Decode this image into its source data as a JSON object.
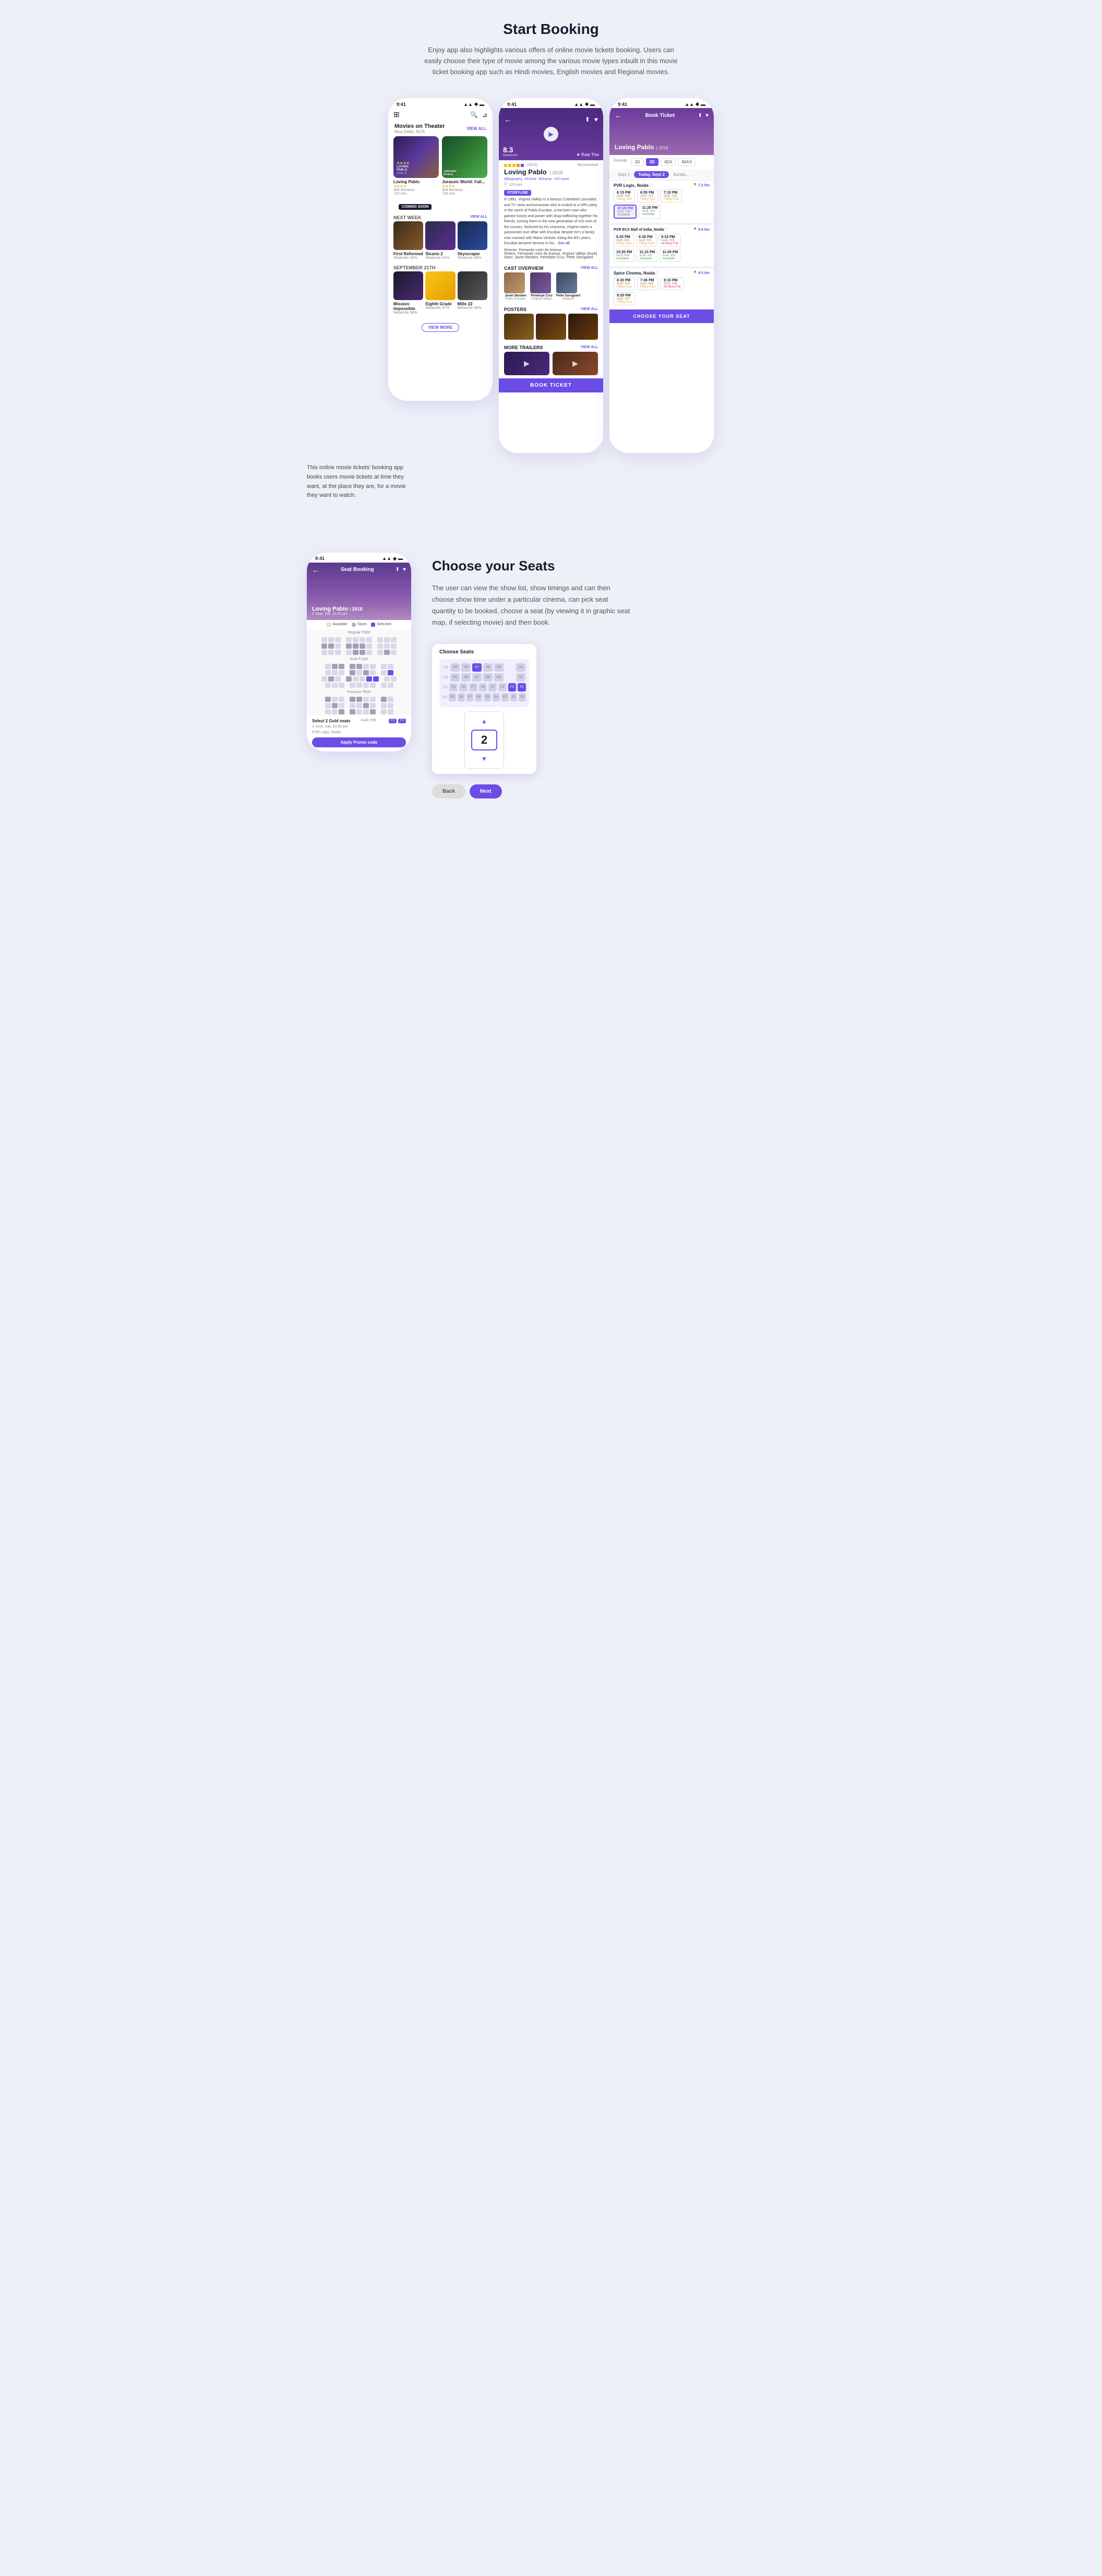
{
  "page": {
    "section1": {
      "title": "Start Booking",
      "description": "Enjoy app also highlights various offers of online movie tickets booking. Users can easily choose their type of movie among the various movie types inbuilt in this movie ticket booking app such as Hindi movies, English movies and Regional movies.",
      "side_text": "This online movie tickets' booking app books users movie tickets at time they want, at the place they are, for a movie they want to watch."
    },
    "section2": {
      "title": "Choose your Seats",
      "description": "The user can view the show list, show timings and can then choose show time under a particular cinema, can pick seat quantity to be booked, choose a seat (by viewing it in graphic seat map, if selecting movie) and then book."
    }
  },
  "phone1": {
    "time": "9:41",
    "header": {
      "title": "Movies on Theater",
      "subtitle": "New Delhi, NCR",
      "view_all": "VIEW ALL"
    },
    "movies": [
      {
        "title": "Loving Pablo",
        "reviews": "280 Reviews",
        "duration": "123 min",
        "type": "pablo"
      },
      {
        "title": "Jurassic World: Fall...",
        "reviews": "304 Reviews",
        "duration": "128 min",
        "type": "jurassic"
      }
    ],
    "coming_soon_label": "COMING SOON",
    "next_week_label": "NEXT WEEK",
    "view_all_next": "VIEW ALL",
    "next_week_movies": [
      {
        "title": "First Reformed",
        "meta": "Metacritic 96%",
        "type": "reformed"
      },
      {
        "title": "Sicario 2",
        "meta": "Metacritic 61%",
        "type": "sicario"
      },
      {
        "title": "Skyscraper",
        "meta": "Metacritic 88%",
        "type": "skyscraper"
      }
    ],
    "september_label": "SEPTEMBER 21TH",
    "september_movies": [
      {
        "title": "Mission: Impossible",
        "meta": "Metacritic 96%",
        "type": "fallout"
      },
      {
        "title": "Eighth Grade",
        "meta": "Metacritic 87%",
        "type": "eighth"
      },
      {
        "title": "Mille 22",
        "meta": "Metacritic 88%",
        "type": "mile22"
      }
    ],
    "view_more": "VIEW MORE"
  },
  "phone2": {
    "time": "9:41",
    "rating": "8.3",
    "rating_source": "Metascore",
    "reviews_count": ":::Critic Review",
    "recommend_pct": "Recommend",
    "stars": "★★★★☆",
    "reviews_num": "(3021)",
    "movie_title": "Loving Pablo",
    "movie_year": "2018",
    "tags": [
      "#Biography",
      "#Crime",
      "#Drama"
    ],
    "duration": "123 min",
    "storyline_label": "STORYLINE",
    "story": "In 1981, Virginia Vallejo is a famous Colombia's journalist and TV news anchorwoman who is invited to a VIPs party in the ranch of Pablo Escobar, a low-born man who gained money and power with drug trafficking together his friends, turning them in the new generation of rich men of the country. Seduced by his charisma, Virginia starts a passionate love affair with Escobar despite he's a family man married with Maria Victoria. Along the 80's years, Escobar became famous in his...",
    "see_more": "See all",
    "director": "Director: Fernando León de Aranoa",
    "writers": "Writers: Fernando León de Aranoa, Virginia Vallejo (book)",
    "stars_label": "Stars: Javier Bardem, Penélope Cruz, Peter Sarsgaard",
    "cast_section": "CAST OVERVIEW",
    "cast": [
      {
        "name": "Javier Bardem",
        "role": "Pablo Escobar",
        "type": "cast1"
      },
      {
        "name": "Penélope Cruz",
        "role": "Virginia Vallejo",
        "type": "cast2"
      },
      {
        "name": "Peter Sarsgaard",
        "role": "Shepard",
        "type": "cast3"
      }
    ],
    "posters_label": "POSTERS",
    "trailers_label": "MORE TRAILERS",
    "view_all": "VIEW ALL",
    "book_ticket": "BOOK TICKET"
  },
  "phone3": {
    "time": "9:41",
    "nav_title": "Book Ticket",
    "movie_title": "Loving Pablo",
    "movie_year": "2018",
    "formats": [
      "2D",
      "3D",
      "4DX",
      "IMAX"
    ],
    "active_format": "3D",
    "dates": [
      "Sept 1",
      "Today, Sept 2",
      "Sunda..."
    ],
    "active_date": "Today, Sept 2",
    "cinemas": [
      {
        "name": "PVR Logix, Noida",
        "distance": "7.2 km",
        "showtimes": [
          {
            "time": "6:15 PM",
            "audi": "Audi: #09",
            "status": "Filling Fast",
            "status_type": "orange"
          },
          {
            "time": "6:55 PM",
            "audi": "Audi: #02",
            "status": "Filling Fast",
            "status_type": "orange"
          },
          {
            "time": "7:15 PM",
            "audi": "Audi: #05",
            "status": "Filling Fast",
            "status_type": "orange"
          },
          {
            "time": "10:20 PM",
            "audi": "Audi: #06",
            "status": "Available",
            "status_type": "green",
            "selected": true
          },
          {
            "time": "11:25 PM",
            "audi": "Audi: #01",
            "status": "Available",
            "status_type": "green"
          }
        ]
      },
      {
        "name": "PVR ECX Mall of India, Noida",
        "distance": "8.9 km",
        "showtimes": [
          {
            "time": "6:25 PM",
            "audi": "Audi: #02",
            "status": "Filling Fast",
            "status_type": "orange"
          },
          {
            "time": "6:35 PM",
            "audi": "Audi: #01",
            "status": "Filling Fast",
            "status_type": "orange"
          },
          {
            "time": "9:15 PM",
            "audi": "Audi: #03",
            "status": "All Most Full",
            "status_type": "red"
          },
          {
            "time": "10:20 PM",
            "audi": "Audi: #04",
            "status": "Available",
            "status_type": "green"
          },
          {
            "time": "11:15 PM",
            "audi": "Audi: #01",
            "status": "Available",
            "status_type": "green"
          },
          {
            "time": "11:45 PM",
            "audi": "Audi: #02",
            "status": "Available",
            "status_type": "green"
          }
        ]
      },
      {
        "name": "Spice Cinema, Noida",
        "distance": "9.5 km",
        "showtimes": [
          {
            "time": "6:30 PM",
            "audi": "Audi: #03",
            "status": "Filling Fast",
            "status_type": "orange"
          },
          {
            "time": "7:45 PM",
            "audi": "Audi: #05",
            "status": "Filling Fast",
            "status_type": "orange"
          },
          {
            "time": "8:15 PM",
            "audi": "Audi: #08",
            "status": "All Most Full",
            "status_type": "red"
          },
          {
            "time": "9:20 PM",
            "audi": "Audi: #01",
            "status": "Filling Fast",
            "status_type": "orange"
          }
        ]
      }
    ],
    "choose_seat": "CHOOSE YOUR SEAT"
  },
  "phone_seat": {
    "time": "9:41",
    "nav_title": "Seat Booking",
    "movie_title": "Loving Pablo",
    "movie_year": "2018",
    "movie_date": "2 Sept, Sat, 10:20 pm",
    "legend": {
      "available": "Available",
      "taken": "Taken",
      "selected": "Selected"
    },
    "regular_price": "Regular ₹300",
    "gold_price": "Gold ₹ 600",
    "premium_price": "Premium ₹600",
    "selected_seats": "Select 2 Gold seats",
    "selected_date": "3 June, Sat, 10:00 pm",
    "cinema": "PVR Logix, Noida",
    "seat_numbers": "F2  F3",
    "audi": "Audi: #56",
    "promo_btn": "Apply Promo code"
  },
  "choose_seats_popup": {
    "title": "Choose Seats",
    "count": "2",
    "seat_rows": [
      {
        "label": "H9",
        "seats": [
          "H9",
          "H8",
          "H7",
          "H6",
          "H5",
          "",
          "H1"
        ]
      },
      {
        "label": "G9",
        "seats": [
          "G9",
          "G8",
          "G7",
          "G6",
          "G5",
          "",
          "G1"
        ]
      },
      {
        "label": "F9",
        "seats": [
          "F9",
          "F8",
          "F7",
          "F6",
          "F5",
          "F4",
          "F3",
          "F2",
          ""
        ]
      },
      {
        "label": "E9",
        "seats": [
          "E9",
          "E8",
          "E7",
          "E6",
          "E5",
          "E4",
          "E3",
          "E2",
          "E1"
        ]
      }
    ]
  },
  "ui": {
    "accent_color": "#6c4de6",
    "status_bar_icons": "▲▲ ◆",
    "back_arrow": "←",
    "heart": "♥",
    "share": "⬆",
    "play": "▶",
    "search": "🔍",
    "grid": "⊞",
    "location": "📍"
  }
}
